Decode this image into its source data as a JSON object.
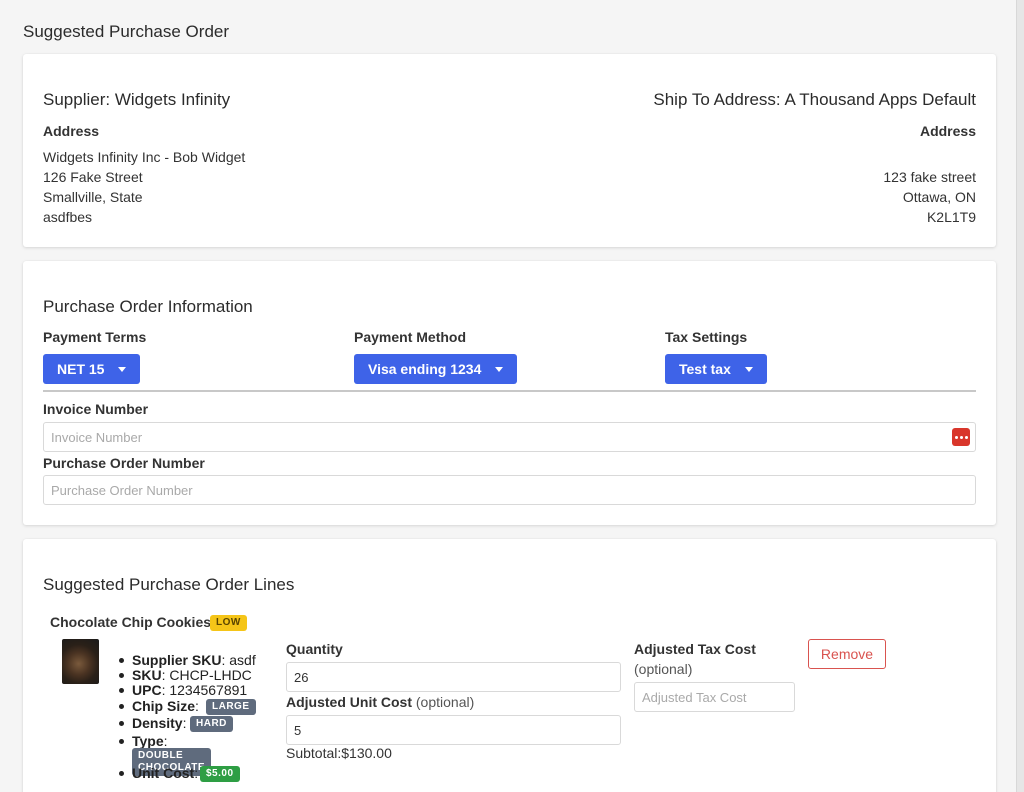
{
  "page": {
    "title": "Suggested Purchase Order"
  },
  "supplier": {
    "heading": "Supplier: Widgets Infinity",
    "address_label": "Address",
    "lines": [
      "Widgets Infinity Inc - Bob Widget",
      "126 Fake Street",
      "Smallville, State",
      "asdfbes"
    ]
  },
  "ship_to": {
    "heading": "Ship To Address: A Thousand Apps Default",
    "address_label": "Address",
    "lines": [
      "123 fake street",
      "Ottawa, ON",
      "K2L1T9"
    ]
  },
  "po_info": {
    "heading": "Purchase Order Information",
    "payment_terms": {
      "label": "Payment Terms",
      "value": "NET 15"
    },
    "payment_method": {
      "label": "Payment Method",
      "value": "Visa ending 1234"
    },
    "tax_settings": {
      "label": "Tax Settings",
      "value": "Test tax"
    },
    "invoice_number": {
      "label": "Invoice Number",
      "placeholder": "Invoice Number",
      "value": ""
    },
    "po_number": {
      "label": "Purchase Order Number",
      "placeholder": "Purchase Order Number",
      "value": ""
    }
  },
  "lines": {
    "heading": "Suggested Purchase Order Lines",
    "items": [
      {
        "name": "Chocolate Chip Cookies",
        "stock_badge": "LOW",
        "specs": {
          "supplier_sku_label": "Supplier SKU",
          "supplier_sku": "asdf",
          "sku_label": "SKU",
          "sku": "CHCP-LHDC",
          "upc_label": "UPC",
          "upc": "1234567891",
          "chip_size_label": "Chip Size",
          "chip_size": "LARGE",
          "density_label": "Density",
          "density": "HARD",
          "type_label": "Type",
          "type": "DOUBLE CHOCOLATE",
          "unit_cost_label": "Unit Cost",
          "unit_cost": "$5.00"
        },
        "quantity_label": "Quantity",
        "quantity": "26",
        "adjusted_unit_cost_label": "Adjusted Unit Cost",
        "adjusted_unit_cost_hint": "(optional)",
        "adjusted_unit_cost": "5",
        "subtotal": "Subtotal:$130.00",
        "adjusted_tax_cost_label": "Adjusted Tax Cost",
        "adjusted_tax_cost_hint": "(optional)",
        "adjusted_tax_cost_placeholder": "Adjusted Tax Cost",
        "remove_label": "Remove"
      }
    ]
  },
  "colors": {
    "primary": "#3e63e8",
    "danger": "#d9534f",
    "warning": "#f5c518",
    "success": "#2e9e44",
    "secondary": "#5f6b7d"
  },
  "icons": {
    "invoice_field_addon": "more-dots-icon",
    "dropdown": "caret-down-icon"
  }
}
